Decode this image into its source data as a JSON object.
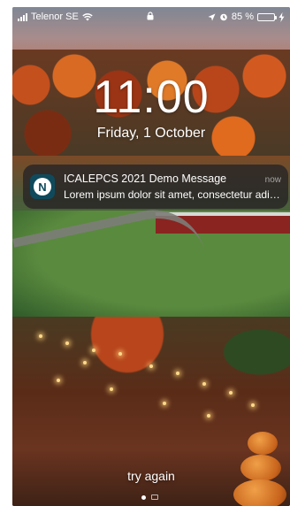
{
  "status_bar": {
    "carrier": "Telenor SE",
    "battery_percent": "85 %",
    "battery_level": 0.85,
    "icons": [
      "signal-icon",
      "wifi-icon",
      "lock-icon",
      "location-icon",
      "alarm-icon",
      "battery-icon",
      "charging-icon"
    ]
  },
  "lockscreen": {
    "time": "11:00",
    "date": "Friday, 1 October"
  },
  "notification": {
    "app_icon_letter": "N",
    "title": "ICALEPCS 2021 Demo Message",
    "time": "now",
    "body": "Lorem ipsum dolor sit amet, consectetur adipiscing elit"
  },
  "footer": {
    "prompt": "try again"
  }
}
